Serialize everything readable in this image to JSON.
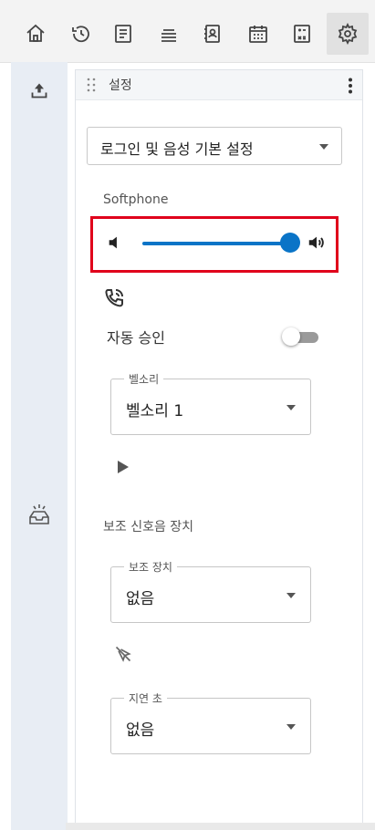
{
  "toolbar": {
    "buttons": [
      {
        "icon": "home-icon"
      },
      {
        "icon": "history-icon"
      },
      {
        "icon": "document-icon"
      },
      {
        "icon": "queue-icon"
      },
      {
        "icon": "contacts-icon"
      },
      {
        "icon": "calendar-icon"
      },
      {
        "icon": "calculator-icon"
      },
      {
        "icon": "gear-icon",
        "active": true
      }
    ]
  },
  "rail": {
    "items": [
      {
        "icon": "upload-icon"
      },
      {
        "icon": "inbox-icon"
      }
    ]
  },
  "panel": {
    "title": "설정"
  },
  "profile": {
    "selected": "로그인 및 음성 기본 설정"
  },
  "softphone": {
    "label": "Softphone",
    "volume_percent": 100
  },
  "auto_answer": {
    "label": "자동 승인",
    "enabled": false
  },
  "ringtone": {
    "legend": "벨소리",
    "value": "벨소리 1"
  },
  "aux_ring": {
    "label": "보조 신호음 장치"
  },
  "aux_device": {
    "legend": "보조 장치",
    "value": "없음"
  },
  "delay": {
    "legend": "지연 초",
    "value": "없음"
  },
  "colors": {
    "accent": "#0a74c7",
    "highlight_border": "#e0001b"
  }
}
